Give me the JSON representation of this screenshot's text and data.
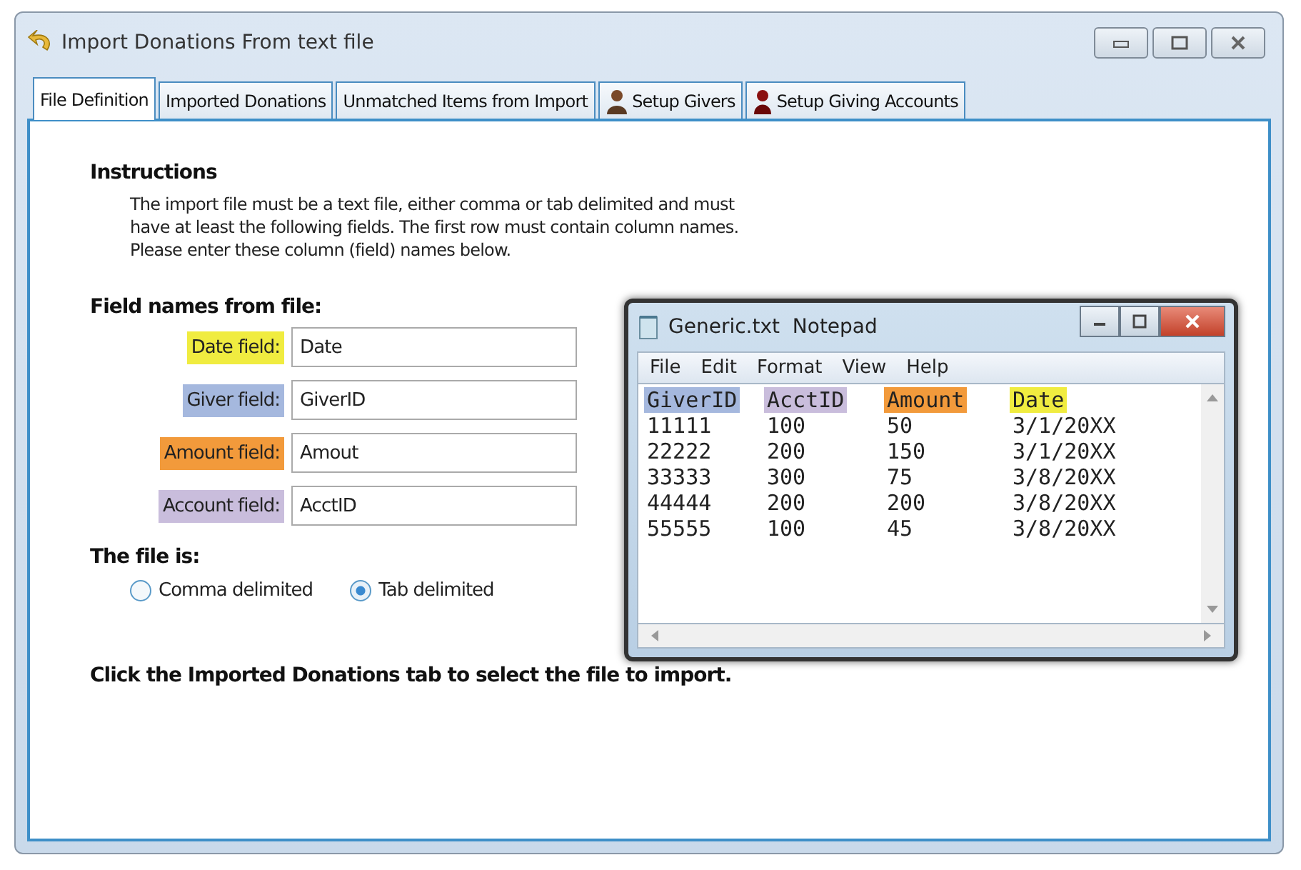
{
  "window": {
    "title": "Import Donations From text file"
  },
  "tabs": [
    {
      "label": "File Definition",
      "selected": true,
      "kind": "plain"
    },
    {
      "label": "Imported Donations",
      "selected": false,
      "kind": "plain"
    },
    {
      "label": "Unmatched Items from Import",
      "selected": false,
      "kind": "plain"
    },
    {
      "label": "Setup Givers",
      "selected": false,
      "kind": "person"
    },
    {
      "label": "Setup Giving Accounts",
      "selected": false,
      "kind": "account"
    }
  ],
  "instructions": {
    "heading": "Instructions",
    "text": [
      "The import file must be a text file, either comma or tab delimited and must",
      "have at least the following fields. The first row must contain column names.",
      "Please enter these column (field) names below."
    ]
  },
  "fields": {
    "heading": "Field names from file:",
    "items": [
      {
        "label": "Date field:",
        "value": "Date",
        "color": "#f0ec40"
      },
      {
        "label": "Giver field:",
        "value": "GiverID",
        "color": "#a5b8de"
      },
      {
        "label": "Amount field:",
        "value": "Amout",
        "color": "#f29a3b"
      },
      {
        "label": "Account field:",
        "value": "AcctID",
        "color": "#c9bddc"
      }
    ]
  },
  "file_type": {
    "heading": "The file is:",
    "options": [
      {
        "label": "Comma delimited",
        "selected": false
      },
      {
        "label": "Tab delimited",
        "selected": true
      }
    ]
  },
  "footer": "Click the Imported Donations tab to select the file to import.",
  "notepad": {
    "title": "Generic.txt  Notepad",
    "menu": [
      "File",
      "Edit",
      "Format",
      "View",
      "Help"
    ],
    "columns": [
      {
        "header": "GiverID",
        "color": "#a5b8de"
      },
      {
        "header": "AcctID",
        "color": "#c9bddc"
      },
      {
        "header": "Amount",
        "color": "#f29a3b"
      },
      {
        "header": "Date",
        "color": "#f0ec40"
      }
    ],
    "rows": [
      [
        "11111",
        "100",
        "50",
        "3/1/20XX"
      ],
      [
        "22222",
        "200",
        "150",
        "3/1/20XX"
      ],
      [
        "33333",
        "300",
        "75",
        "3/8/20XX"
      ],
      [
        "44444",
        "200",
        "200",
        "3/8/20XX"
      ],
      [
        "55555",
        "100",
        "45",
        "3/8/20XX"
      ]
    ]
  }
}
